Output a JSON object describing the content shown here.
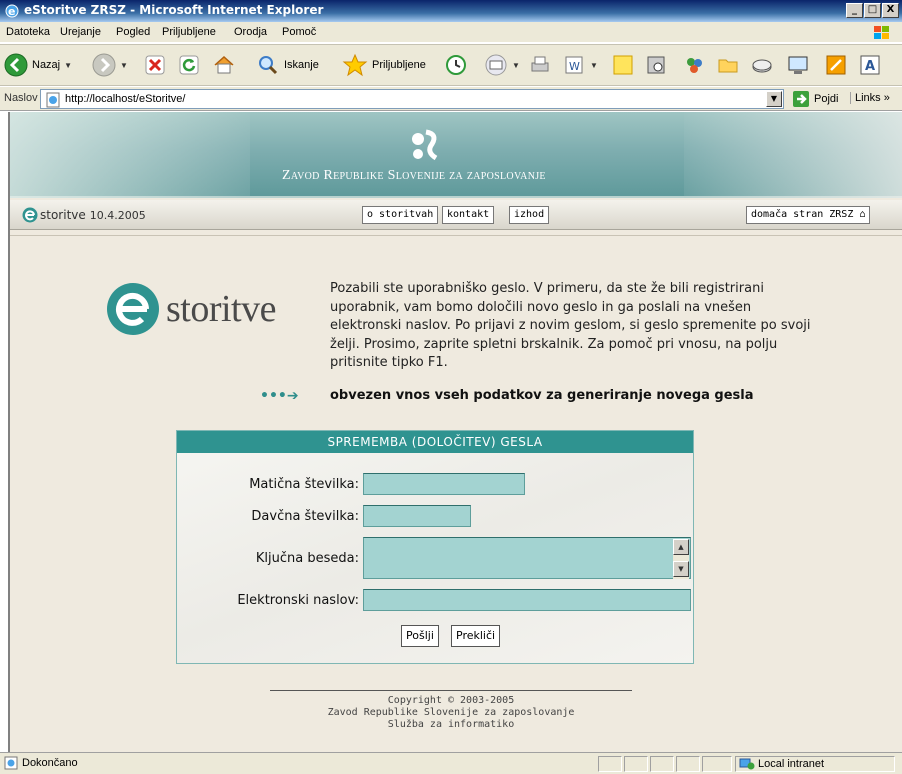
{
  "window": {
    "title": "eStoritve ZRSZ - Microsoft Internet Explorer",
    "buttons": [
      "_",
      "□",
      "X"
    ]
  },
  "menu": [
    "Datoteka",
    "Urejanje",
    "Pogled",
    "Priljubljene",
    "Orodja",
    "Pomoč"
  ],
  "toolbar": {
    "back": "Nazaj",
    "search": "Iskanje",
    "favorites": "Priljubljene"
  },
  "address": {
    "label": "Naslov",
    "url": "http://localhost/eStoritve/",
    "go": "Pojdi",
    "links": "Links"
  },
  "page": {
    "banner_title": "Zavod Republike Slovenije za zaposlovanje",
    "brand": "storitve",
    "date": "10.4.2005",
    "nav": [
      "o storitvah",
      "kontakt",
      "izhod"
    ],
    "home_link": "domača stran ZRSZ",
    "logo_text": "storitve",
    "intro": "Pozabili ste uporabniško geslo. V primeru, da ste že bili registrirani uporabnik, vam bomo določili novo geslo in ga poslali na vnešen elektronski naslov. Po prijavi z novim geslom, si geslo spremenite po svoji želji. Prosimo, zaprite spletni brskalnik. Za pomoč pri vnosu, na polju pritisnite tipko F1.",
    "arrows": "•••➔",
    "required_note": "obvezen vnos vseh podatkov za generiranje novega gesla",
    "form": {
      "title": "SPREMEMBA (DOLOČITEV) GESLA",
      "fields": {
        "maticna": {
          "label": "Matična številka:",
          "value": ""
        },
        "davcna": {
          "label": "Davčna številka:",
          "value": ""
        },
        "kljucna": {
          "label": "Ključna beseda:",
          "value": ""
        },
        "email": {
          "label": "Elektronski naslov:",
          "value": ""
        }
      },
      "submit": "Pošlji",
      "cancel": "Prekliči"
    },
    "footer": [
      "Copyright © 2003-2005",
      "Zavod Republike Slovenije za zaposlovanje",
      "Služba za informatiko"
    ]
  },
  "status": {
    "text": "Dokončano",
    "zone": "Local intranet"
  },
  "colors": {
    "teal": "#2f9390",
    "field": "#a3d3d1",
    "page_bg": "#efeadf"
  }
}
